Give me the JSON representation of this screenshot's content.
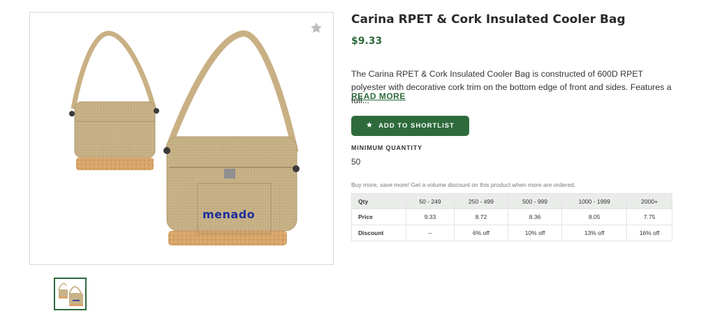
{
  "product": {
    "title": "Carina RPET & Cork Insulated Cooler Bag",
    "price": "$9.33",
    "description": "The Carina RPET & Cork Insulated Cooler Bag is constructed of 600D RPET polyester with decorative cork trim on the bottom edge of front and sides. Features a full...",
    "read_more": "READ MORE",
    "shortlist_label": "ADD TO SHORTLIST",
    "logo_text": "menado"
  },
  "min_quantity": {
    "label": "MINIMUM QUANTITY",
    "value": "50"
  },
  "volume_note": "Buy more, save more! Get a volume discount on this product when more are ordered.",
  "pricing": {
    "header": [
      "Qty",
      "50 - 249",
      "250 - 499",
      "500 - 999",
      "1000 - 1999",
      "2000+"
    ],
    "price_row": [
      "Price",
      "9.33",
      "8.72",
      "8.36",
      "8.05",
      "7.75"
    ],
    "discount_row": [
      "Discount",
      "--",
      "6% off",
      "10% off",
      "13% off",
      "16% off"
    ]
  },
  "colors": {
    "brand_green": "#2e6b3c",
    "bag_tan": "#c9b489",
    "cork": "#d7a56a",
    "logo_blue": "#1c2d9c"
  },
  "icons": {
    "favorite": "star-icon",
    "shortlist": "star-icon"
  }
}
